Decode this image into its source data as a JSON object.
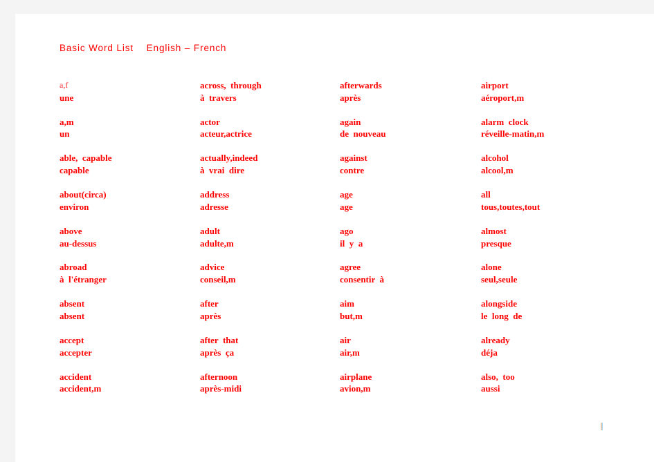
{
  "document": {
    "title": "Basic Word List    English – French",
    "title_main": "Basic Word List",
    "title_languages": "English – French",
    "text_color": "#ff0000",
    "page_background": "#ffffff",
    "canvas_background": "#f4f4f4"
  },
  "columns": [
    {
      "index": 0,
      "entries": [
        {
          "en": "a,f",
          "fr": "une",
          "style": "faint"
        },
        {
          "en": "a,m",
          "fr": "un"
        },
        {
          "en": "able,  capable",
          "fr": "capable"
        },
        {
          "en": "about(circa)",
          "fr": "environ"
        },
        {
          "en": "above",
          "fr": "au-dessus"
        },
        {
          "en": "abroad",
          "fr": "à  l'étranger"
        },
        {
          "en": "absent",
          "fr": "absent"
        },
        {
          "en": "accept",
          "fr": "accepter"
        },
        {
          "en": "accident",
          "fr": "accident,m"
        }
      ]
    },
    {
      "index": 1,
      "entries": [
        {
          "en": "across,  through",
          "fr": "à  travers"
        },
        {
          "en": "actor",
          "fr": "acteur,actrice"
        },
        {
          "en": "actually,indeed",
          "fr": "à  vrai  dire"
        },
        {
          "en": "address",
          "fr": "adresse"
        },
        {
          "en": "adult",
          "fr": "adulte,m"
        },
        {
          "en": "advice",
          "fr": "conseil,m"
        },
        {
          "en": "after",
          "fr": "après"
        },
        {
          "en": "after  that",
          "fr": "après  ça"
        },
        {
          "en": "afternoon",
          "fr": "après-midi"
        }
      ]
    },
    {
      "index": 2,
      "entries": [
        {
          "en": "afterwards",
          "fr": "après"
        },
        {
          "en": "again",
          "fr": "de  nouveau"
        },
        {
          "en": "against",
          "fr": "contre"
        },
        {
          "en": "age",
          "fr": "age"
        },
        {
          "en": "ago",
          "fr": "il  y  a"
        },
        {
          "en": "agree",
          "fr": "consentir  à"
        },
        {
          "en": "aim",
          "fr": "but,m"
        },
        {
          "en": "air",
          "fr": "air,m"
        },
        {
          "en": "airplane",
          "fr": "avion,m"
        }
      ]
    },
    {
      "index": 3,
      "entries": [
        {
          "en": "airport",
          "fr": "aéroport,m"
        },
        {
          "en": "alarm  clock",
          "fr": "réveille-matin,m"
        },
        {
          "en": "alcohol",
          "fr": "alcool,m"
        },
        {
          "en": "all",
          "fr": "tous,toutes,tout"
        },
        {
          "en": "almost",
          "fr": "presque"
        },
        {
          "en": "alone",
          "fr": "seul,seule"
        },
        {
          "en": "alongside",
          "fr": "le  long  de"
        },
        {
          "en": "already",
          "fr": "déja"
        },
        {
          "en": "also,  too",
          "fr": "aussi"
        }
      ]
    }
  ]
}
